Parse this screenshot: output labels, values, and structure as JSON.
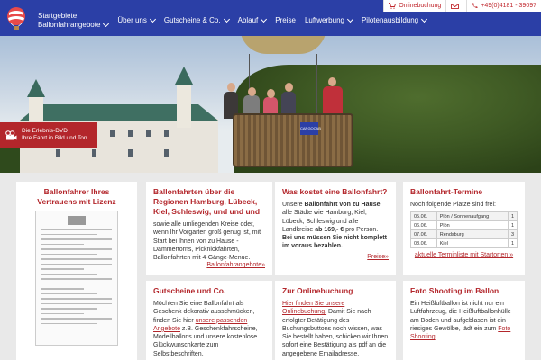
{
  "topbar": {
    "online": "Onlinebuchung",
    "phone": "+49(0)4181 - 39097"
  },
  "nav": {
    "start_line1": "Startgebiete",
    "start_line2": "Ballonfahrangebote",
    "items": [
      "Über uns",
      "Gutscheine & Co.",
      "Ablauf",
      "Preise",
      "Luftwerbung",
      "Pilotenausbildung"
    ]
  },
  "hero": {
    "sign": "CARGOCAB",
    "dvd_line1": "Die Erlebnis-DVD",
    "dvd_line2": "Ihre Fahrt in Bild und Ton"
  },
  "cards": {
    "c1": {
      "title": "Ballonfahrer Ihres Vertrauens mit Lizenz"
    },
    "c2": {
      "title": "Ballonfahrten über die Regionen Hamburg, Lübeck, Kiel, Schleswig, und und und",
      "text": "sowie alle umliegenden Kreise oder, wenn Ihr Vorgarten groß genug ist, mit Start bei Ihnen von zu Hause - Dämmertörns, Picknickfahrten, Ballonfahrten mit 4-Gänge-Menue.",
      "link": "Ballonfahrangebote»"
    },
    "c3": {
      "title": "Was kostet eine Ballonfahrt?",
      "text_a": "Unsere ",
      "bold_a": "Ballonfahrt von zu Hause",
      "text_b": ", alle Städte wie Hamburg, Kiel, Lübeck, Schleswig und alle Landkreise ",
      "bold_b": "ab 169,- €",
      "text_c": " pro Person. ",
      "bold_c": "Bei uns müssen Sie nicht komplett im voraus bezahlen.",
      "link": "Preise»"
    },
    "c4": {
      "title": "Ballonfahrt-Termine",
      "subtitle": "Noch folgende Plätze sind frei:",
      "rows": [
        {
          "date": "05.06.",
          "place": "Plön / Sonnenaufgang",
          "n": "1"
        },
        {
          "date": "06.06.",
          "place": "Plön",
          "n": "1"
        },
        {
          "date": "07.06.",
          "place": "Rendsburg",
          "n": "3"
        },
        {
          "date": "08.06.",
          "place": "Kiel",
          "n": "1"
        }
      ],
      "link": "aktuelle Terminliste mit Startorten »"
    },
    "c5": {
      "title": "Gutscheine und Co.",
      "text_a": "Möchten Sie eine Ballonfahrt als Geschenk dekorativ ausschmücken, finden Sie hier ",
      "link": "unsere passenden Angebote",
      "text_b": " z.B. Geschenkfahrscheine, Modellballons und unsere kostenlose Glückwunschkarte zum Selbstbeschriften."
    },
    "c6": {
      "title": "Zur Onlinebuchung",
      "link": "Hier finden Sie unsere Onlinebuchung.",
      "text": " Damit Sie nach erfolgter Betätigung des Buchungsbuttons noch wissen, was Sie bestellt haben, schicken wir Ihnen sofort eine Bestätigung als pdf an die angegebene Emailadresse."
    },
    "c7": {
      "title": "Foto Shooting im Ballon",
      "text": "Ein Heißluftballon ist nicht nur ein Luftfahrzeug, die Heißluftballonhülle am Boden und aufgeblasen ist ein riesiges Gewölbe, lädt ein zum ",
      "link": "Foto Shooting",
      "text_end": "."
    }
  }
}
